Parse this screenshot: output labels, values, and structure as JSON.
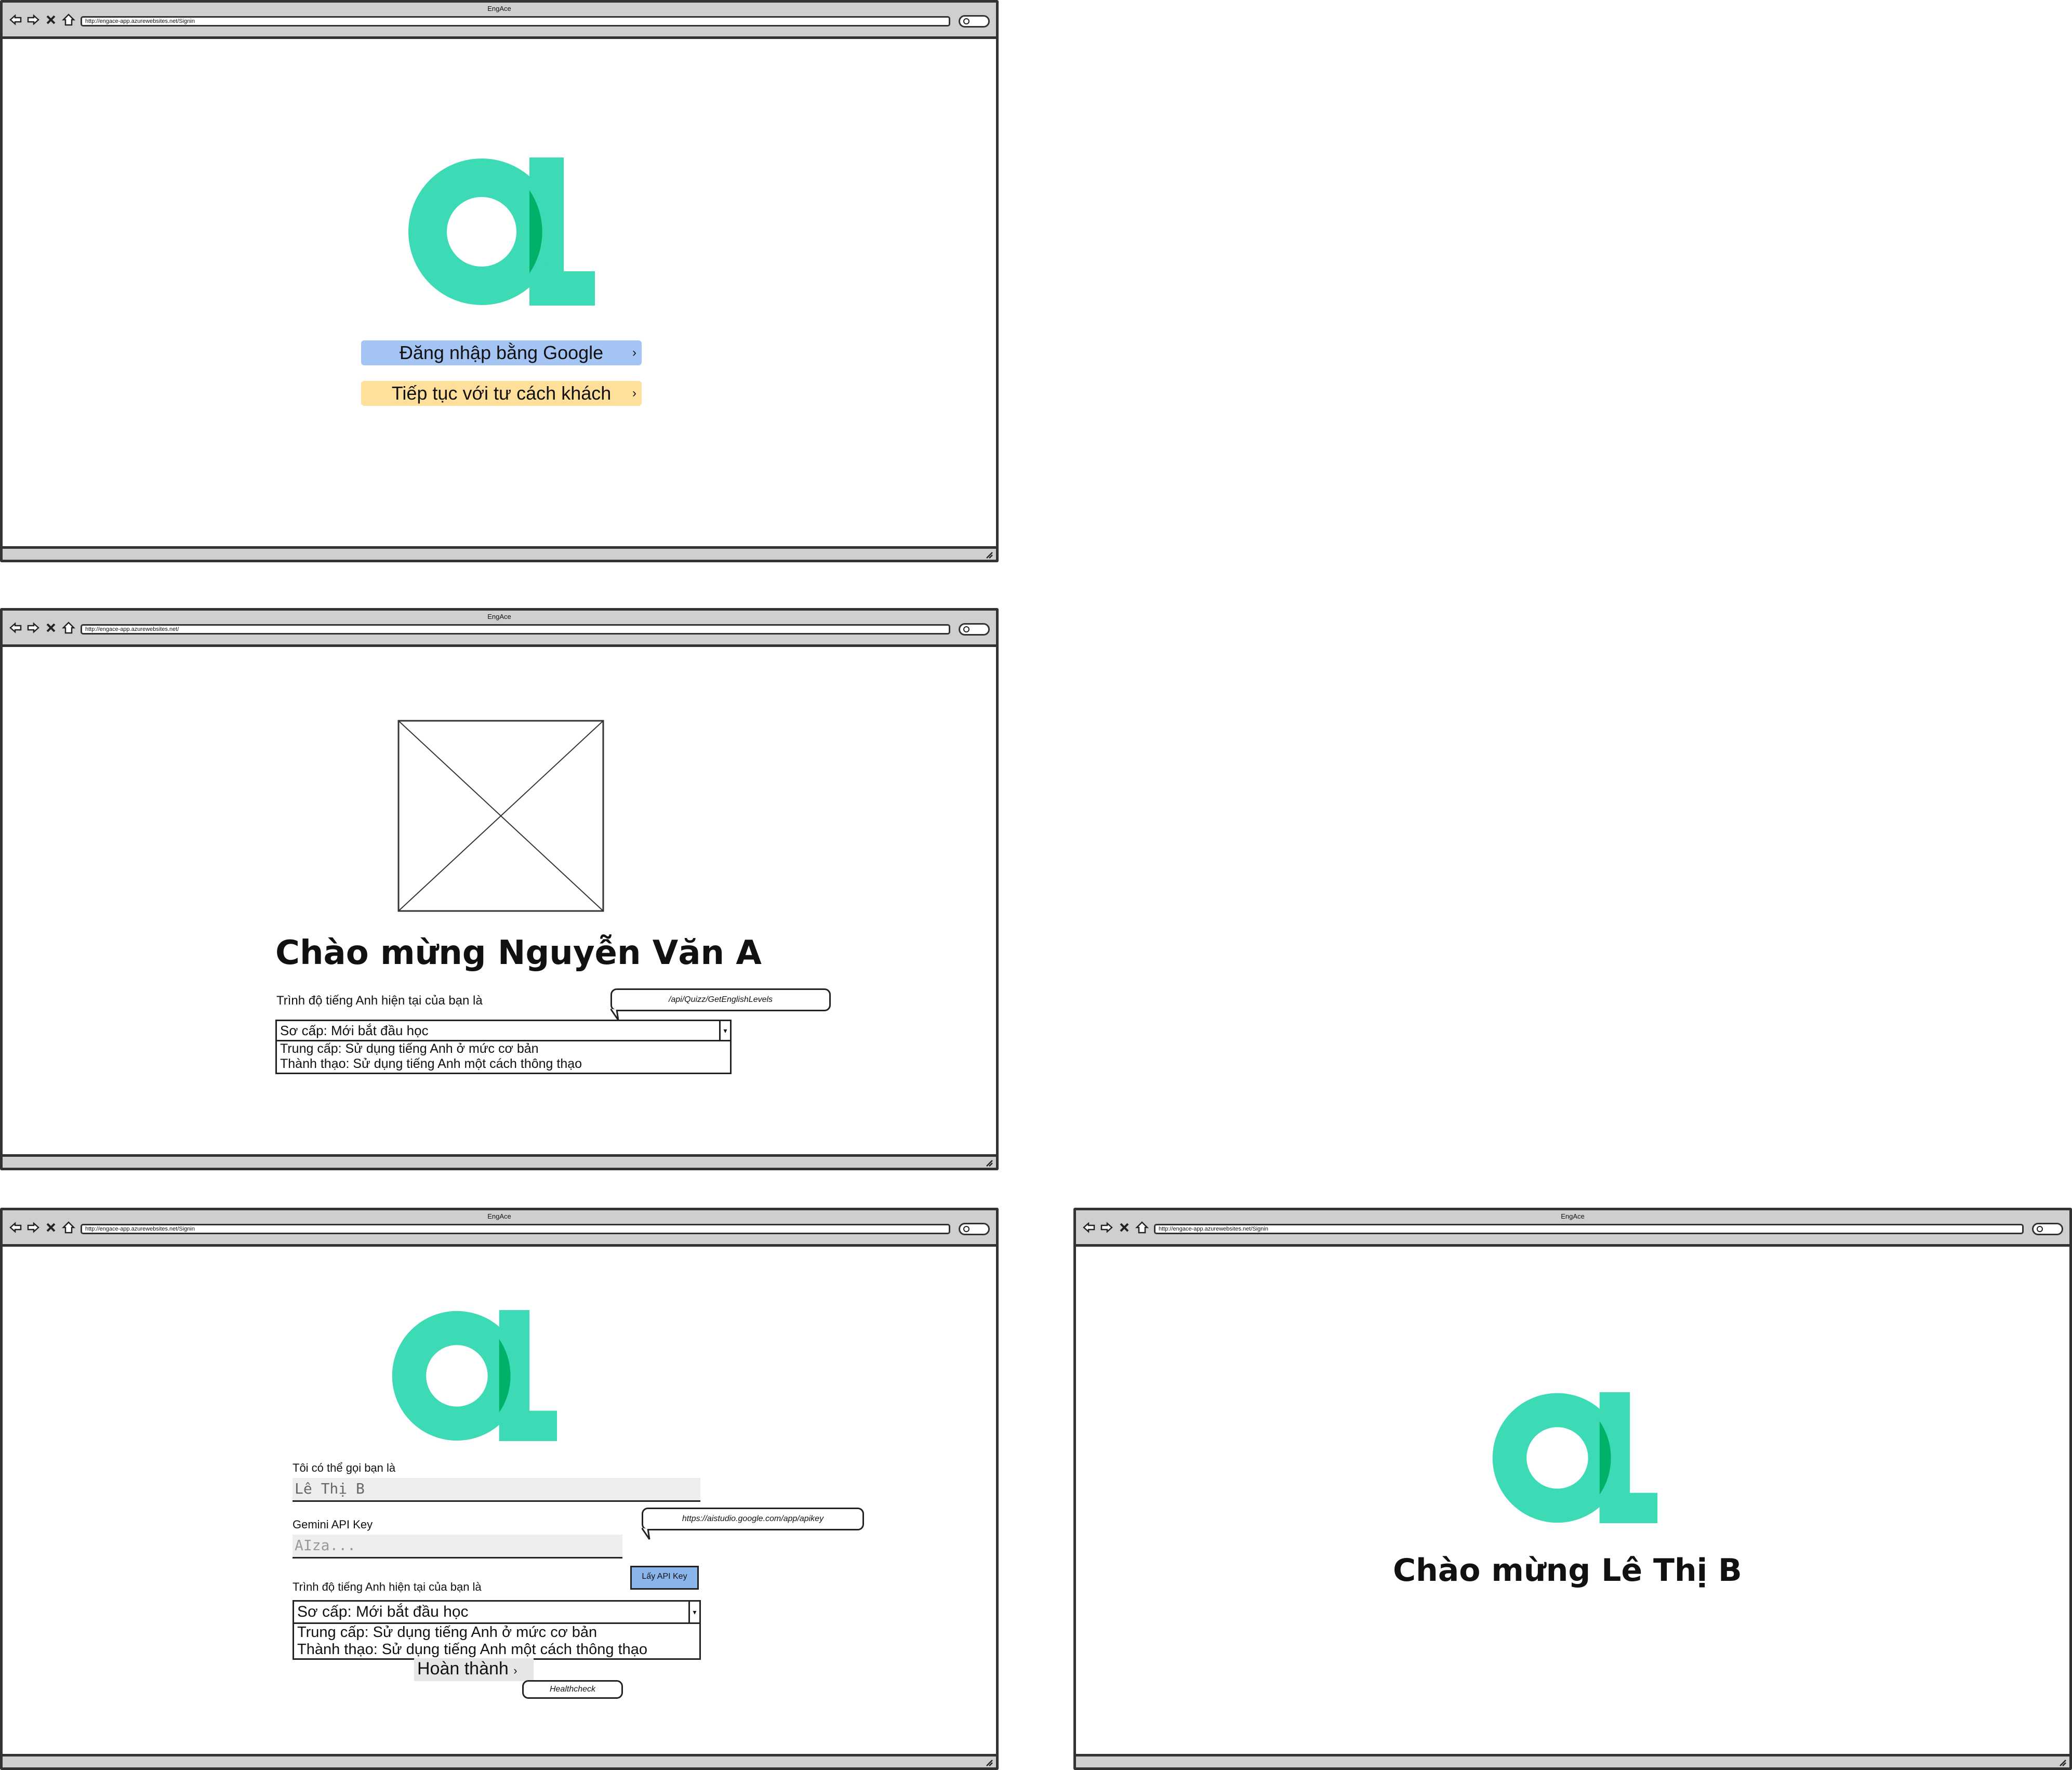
{
  "colors": {
    "logo_green": "#3ddbb5",
    "logo_overlap": "#00b16a",
    "google_button_bg": "#a4c4f4",
    "guest_button_bg": "#ffdf9a",
    "api_key_button_bg": "#89b4ec"
  },
  "icons": [
    "back-arrow-icon",
    "forward-arrow-icon",
    "close-icon",
    "home-icon",
    "search-icon",
    "resize-grip-icon",
    "chevron-right-icon",
    "dropdown-arrow-icon"
  ],
  "screen1": {
    "title": "EngAce",
    "url": "http://engace-app.azurewebsites.net/Signin",
    "google_button": "Đăng nhập bằng Google",
    "guest_button": "Tiếp tục với tư cách khách",
    "chevron": "›"
  },
  "screen2": {
    "title": "EngAce",
    "url": "http://engace-app.azurewebsites.net/",
    "welcome": "Chào mừng Nguyễn Văn A",
    "level_label": "Trình độ tiếng Anh hiện tại của bạn là",
    "api_note": "/api/Quizz/GetEnglishLevels",
    "selected_level": "Sơ cấp: Mới bắt đầu học",
    "options": [
      "Trung cấp: Sử dụng tiếng Anh ở mức cơ bản",
      "Thành thạo: Sử dụng tiếng Anh một cách thông thạo"
    ]
  },
  "screen3": {
    "title": "EngAce",
    "url": "http://engace-app.azurewebsites.net/Signin",
    "name_label": "Tôi có thể gọi bạn là",
    "name_value": "Lê Thị B",
    "apikey_label": "Gemini API Key",
    "apikey_placeholder": "AIza...",
    "apikey_note": "https://aistudio.google.com/app/apikey",
    "get_apikey_button": "Lấy API Key",
    "level_label": "Trình độ tiếng Anh hiện tại của bạn là",
    "selected_level": "Sơ cấp: Mới bắt đầu học",
    "options": [
      "Trung cấp: Sử dụng tiếng Anh ở mức cơ bản",
      "Thành thạo: Sử dụng tiếng Anh một cách thông thạo"
    ],
    "done_button": "Hoàn thành",
    "healthcheck_note": "Healthcheck",
    "chevron": "›"
  },
  "screen4": {
    "title": "EngAce",
    "url": "http://engace-app.azurewebsites.net/Signin",
    "welcome": "Chào mừng Lê Thị B"
  }
}
